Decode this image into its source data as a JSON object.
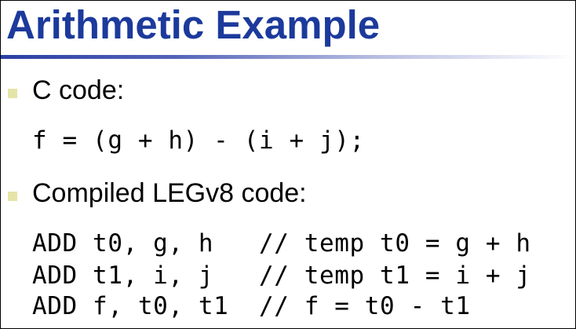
{
  "title": "Arithmetic Example",
  "colors": {
    "title": "#1c3a9c",
    "bullet": "#e5e4a8",
    "rule_start": "#2a3fa3"
  },
  "bullets": [
    {
      "label": "C code:",
      "code_lines": [
        "f = (g + h) - (i + j);"
      ]
    },
    {
      "label": "Compiled LEGv8 code:",
      "code_lines": [
        "ADD t0, g, h   // temp t0 = g + h",
        "ADD t1, i, j   // temp t1 = i + j",
        "ADD f, t0, t1  // f = t0 - t1"
      ]
    }
  ]
}
